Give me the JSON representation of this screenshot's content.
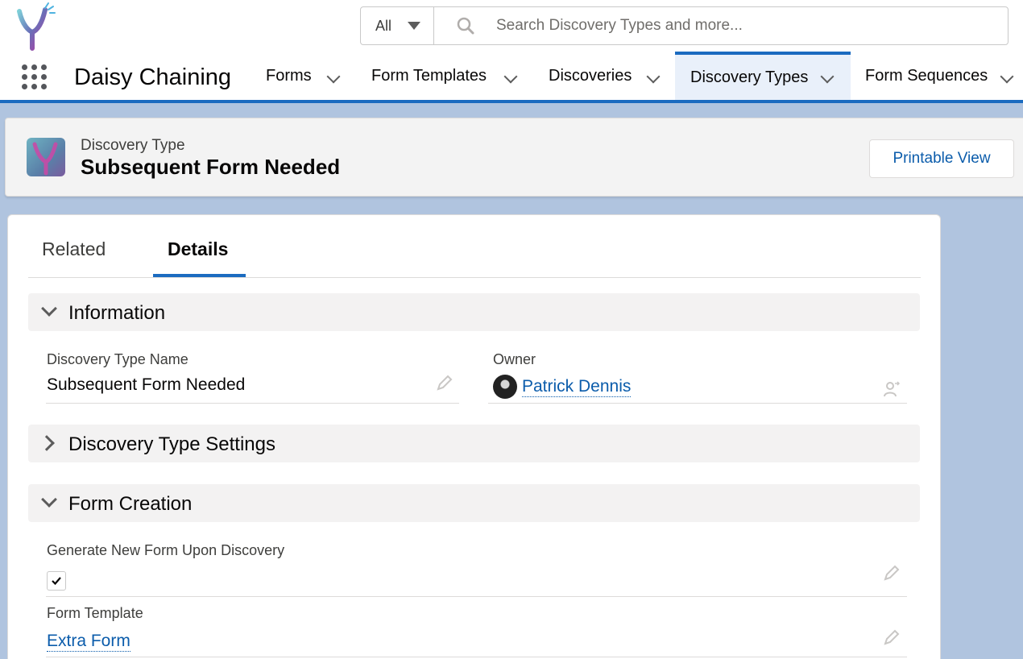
{
  "header": {
    "search_scope": "All",
    "search_placeholder": "Search Discovery Types and more..."
  },
  "nav": {
    "app_name": "Daisy Chaining",
    "items": [
      {
        "label": "Forms",
        "active": false
      },
      {
        "label": "Form Templates",
        "active": false
      },
      {
        "label": "Discoveries",
        "active": false
      },
      {
        "label": "Discovery Types",
        "active": true
      },
      {
        "label": "Form Sequences",
        "active": false
      }
    ]
  },
  "record": {
    "type_label": "Discovery Type",
    "title": "Subsequent Form Needed",
    "printable_view_label": "Printable View"
  },
  "tabs": {
    "related": "Related",
    "details": "Details"
  },
  "sections": {
    "information": {
      "title": "Information",
      "name_label": "Discovery Type Name",
      "name_value": "Subsequent Form Needed",
      "owner_label": "Owner",
      "owner_value": "Patrick Dennis"
    },
    "settings": {
      "title": "Discovery Type Settings"
    },
    "form_creation": {
      "title": "Form Creation",
      "generate_label": "Generate New Form Upon Discovery",
      "generate_checked": true,
      "template_label": "Form Template",
      "template_value": "Extra Form"
    }
  },
  "colors": {
    "brand_blue": "#1b6bc0",
    "link_blue": "#0b5cab",
    "section_bg": "#f3f2f2"
  }
}
